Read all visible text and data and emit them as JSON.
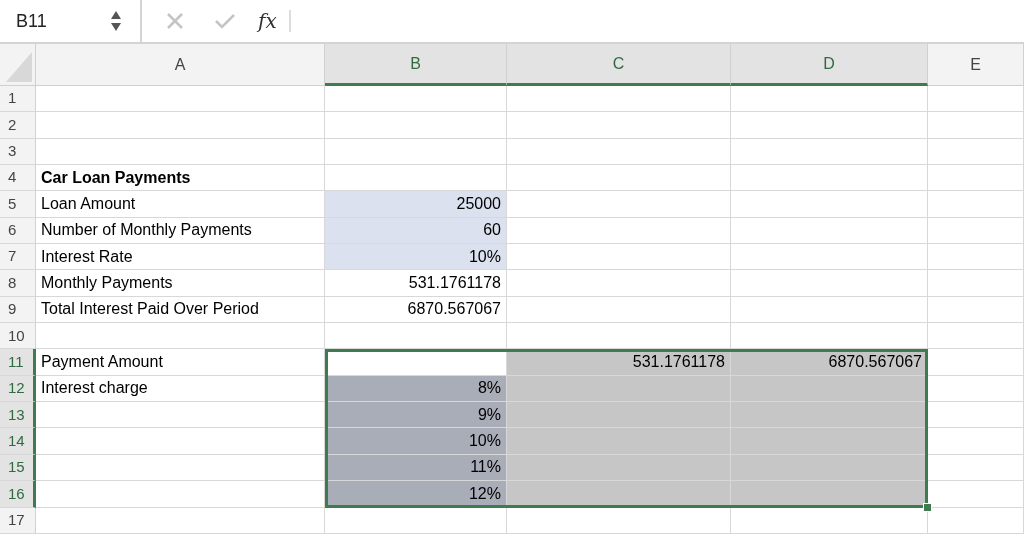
{
  "formula_bar": {
    "name_box": "B11",
    "function_label": "fx"
  },
  "columns": [
    {
      "label": "A",
      "selected": false
    },
    {
      "label": "B",
      "selected": true
    },
    {
      "label": "C",
      "selected": true
    },
    {
      "label": "D",
      "selected": true
    },
    {
      "label": "E",
      "selected": false
    }
  ],
  "rows": [
    {
      "label": "1",
      "selected": false,
      "cells": [
        {
          "kind": "plain"
        },
        {
          "kind": "plain"
        },
        {
          "kind": "plain"
        },
        {
          "kind": "plain"
        },
        {
          "kind": "plain"
        }
      ]
    },
    {
      "label": "2",
      "selected": false,
      "cells": [
        {
          "kind": "plain"
        },
        {
          "kind": "plain"
        },
        {
          "kind": "plain"
        },
        {
          "kind": "plain"
        },
        {
          "kind": "plain"
        }
      ]
    },
    {
      "label": "3",
      "selected": false,
      "cells": [
        {
          "kind": "plain"
        },
        {
          "kind": "plain"
        },
        {
          "kind": "plain"
        },
        {
          "kind": "plain"
        },
        {
          "kind": "plain"
        }
      ]
    },
    {
      "label": "4",
      "selected": false,
      "cells": [
        {
          "kind": "plain",
          "text": "Car Loan Payments",
          "bold": true
        },
        {
          "kind": "plain"
        },
        {
          "kind": "plain"
        },
        {
          "kind": "plain"
        },
        {
          "kind": "plain"
        }
      ]
    },
    {
      "label": "5",
      "selected": false,
      "cells": [
        {
          "kind": "plain",
          "text": "Loan Amount"
        },
        {
          "kind": "input",
          "text": "25000"
        },
        {
          "kind": "plain"
        },
        {
          "kind": "plain"
        },
        {
          "kind": "plain"
        }
      ]
    },
    {
      "label": "6",
      "selected": false,
      "cells": [
        {
          "kind": "plain",
          "text": "Number of Monthly Payments"
        },
        {
          "kind": "input",
          "text": "60"
        },
        {
          "kind": "plain"
        },
        {
          "kind": "plain"
        },
        {
          "kind": "plain"
        }
      ]
    },
    {
      "label": "7",
      "selected": false,
      "cells": [
        {
          "kind": "plain",
          "text": "Interest Rate"
        },
        {
          "kind": "input",
          "text": "10%"
        },
        {
          "kind": "plain"
        },
        {
          "kind": "plain"
        },
        {
          "kind": "plain"
        }
      ]
    },
    {
      "label": "8",
      "selected": false,
      "cells": [
        {
          "kind": "plain",
          "text": "Monthly Payments"
        },
        {
          "kind": "plain",
          "text": "531.1761178"
        },
        {
          "kind": "plain"
        },
        {
          "kind": "plain"
        },
        {
          "kind": "plain"
        }
      ]
    },
    {
      "label": "9",
      "selected": false,
      "cells": [
        {
          "kind": "plain",
          "text": "Total Interest Paid Over Period"
        },
        {
          "kind": "plain",
          "text": "6870.567067"
        },
        {
          "kind": "plain"
        },
        {
          "kind": "plain"
        },
        {
          "kind": "plain"
        }
      ]
    },
    {
      "label": "10",
      "selected": false,
      "cells": [
        {
          "kind": "plain"
        },
        {
          "kind": "plain"
        },
        {
          "kind": "plain"
        },
        {
          "kind": "plain"
        },
        {
          "kind": "plain"
        }
      ]
    },
    {
      "label": "11",
      "selected": true,
      "cells": [
        {
          "kind": "plain",
          "text": "Payment Amount"
        },
        {
          "kind": "active"
        },
        {
          "kind": "highlight",
          "text": "531.1761178"
        },
        {
          "kind": "highlight",
          "text": "6870.567067"
        },
        {
          "kind": "plain"
        }
      ]
    },
    {
      "label": "12",
      "selected": true,
      "cells": [
        {
          "kind": "plain",
          "text": "Interest charge"
        },
        {
          "kind": "highlight_input",
          "text": "8%"
        },
        {
          "kind": "highlight"
        },
        {
          "kind": "highlight"
        },
        {
          "kind": "plain"
        }
      ]
    },
    {
      "label": "13",
      "selected": true,
      "cells": [
        {
          "kind": "plain"
        },
        {
          "kind": "highlight_input",
          "text": "9%"
        },
        {
          "kind": "highlight"
        },
        {
          "kind": "highlight"
        },
        {
          "kind": "plain"
        }
      ]
    },
    {
      "label": "14",
      "selected": true,
      "cells": [
        {
          "kind": "plain"
        },
        {
          "kind": "highlight_input",
          "text": "10%"
        },
        {
          "kind": "highlight"
        },
        {
          "kind": "highlight"
        },
        {
          "kind": "plain"
        }
      ]
    },
    {
      "label": "15",
      "selected": true,
      "cells": [
        {
          "kind": "plain"
        },
        {
          "kind": "highlight_input",
          "text": "11%"
        },
        {
          "kind": "highlight"
        },
        {
          "kind": "highlight"
        },
        {
          "kind": "plain"
        }
      ]
    },
    {
      "label": "16",
      "selected": true,
      "cells": [
        {
          "kind": "plain"
        },
        {
          "kind": "highlight_input",
          "text": "12%"
        },
        {
          "kind": "highlight"
        },
        {
          "kind": "highlight"
        },
        {
          "kind": "plain"
        }
      ]
    },
    {
      "label": "17",
      "selected": false,
      "cells": [
        {
          "kind": "plain"
        },
        {
          "kind": "plain"
        },
        {
          "kind": "plain"
        },
        {
          "kind": "plain"
        },
        {
          "kind": "plain"
        }
      ]
    }
  ]
}
